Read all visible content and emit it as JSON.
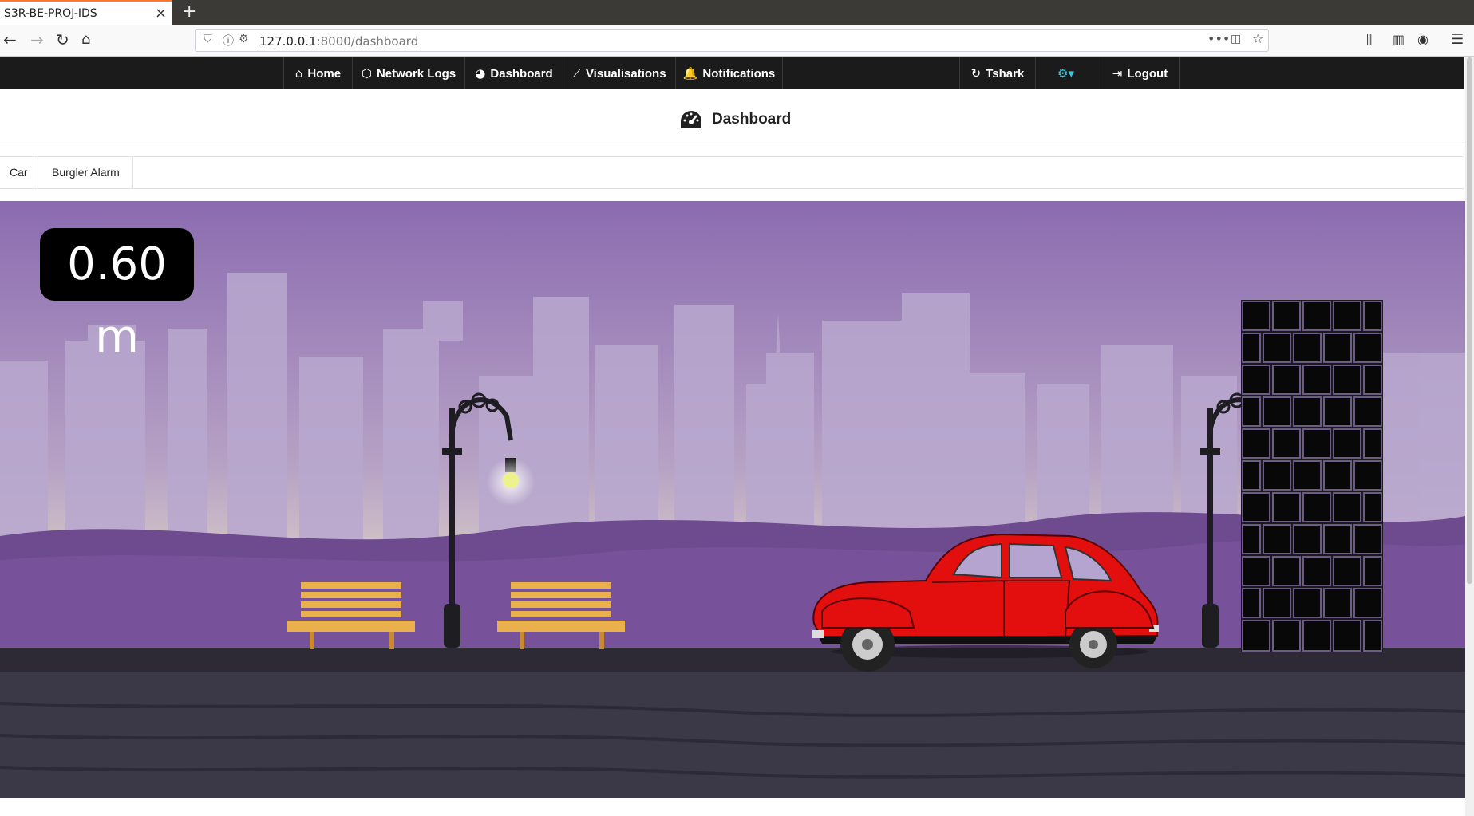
{
  "browser": {
    "tab_title": "S3R-BE-PROJ-IDS",
    "tab_close": "×",
    "new_tab": "+",
    "url_host": "127.0.0.1",
    "url_rest": ":8000/dashboard"
  },
  "nav": {
    "items": [
      {
        "label": "Home",
        "icon": "home-icon"
      },
      {
        "label": "Network Logs",
        "icon": "network-icon"
      },
      {
        "label": "Dashboard",
        "icon": "dashboard-icon"
      },
      {
        "label": "Visualisations",
        "icon": "chart-icon"
      },
      {
        "label": "Notifications",
        "icon": "bell-icon"
      }
    ],
    "right": [
      {
        "label": "Tshark",
        "icon": "refresh-icon"
      },
      {
        "label": "",
        "icon": "gear-icon"
      },
      {
        "label": "Logout",
        "icon": "logout-icon"
      }
    ]
  },
  "page": {
    "title": "Dashboard"
  },
  "tabs": [
    "Car",
    "Burgler Alarm"
  ],
  "scene": {
    "distance": "0.60 m"
  }
}
